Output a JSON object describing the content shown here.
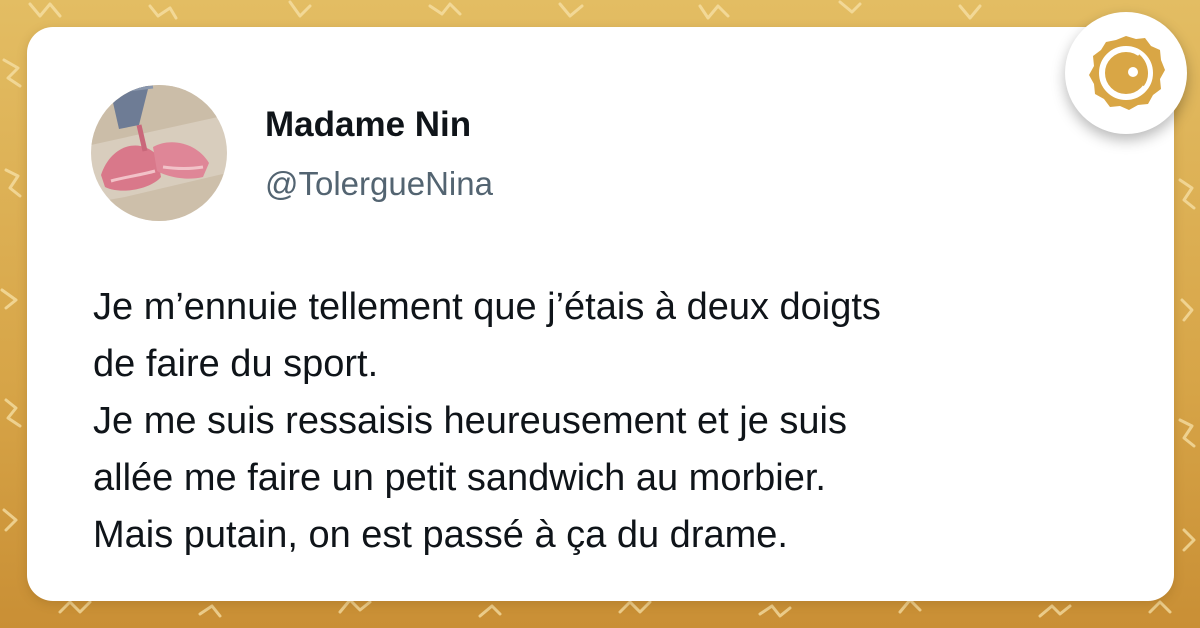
{
  "brand": {
    "logo_icon": "round-face-logo-icon",
    "accent": "#d9a645"
  },
  "tweet": {
    "author_name": "Madame Nin",
    "author_handle": "@TolergueNina",
    "lines": [
      "Je m’ennuie tellement que j’étais à deux doigts",
      "de faire du sport.",
      "Je me suis ressaisis heureusement et je suis",
      "allée me faire un petit sandwich au morbier.",
      "Mais putain, on est passé à ça du drame."
    ]
  }
}
